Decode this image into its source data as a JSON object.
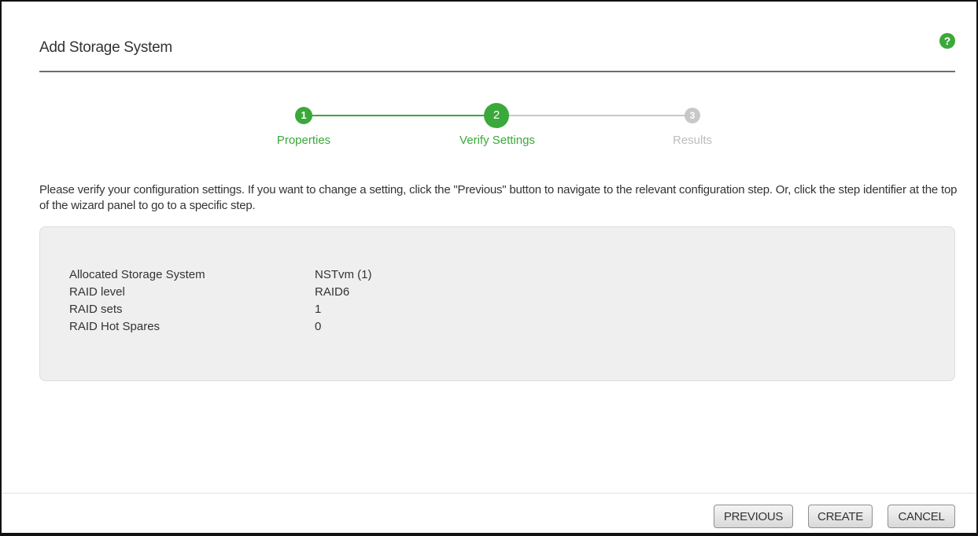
{
  "dialog": {
    "title": "Add Storage System",
    "help_icon": "?"
  },
  "stepper": {
    "steps": [
      {
        "number": "1",
        "label": "Properties",
        "state": "completed"
      },
      {
        "number": "2",
        "label": "Verify Settings",
        "state": "current"
      },
      {
        "number": "3",
        "label": "Results",
        "state": "pending"
      }
    ]
  },
  "instructions": "Please verify your configuration settings. If you want to change a setting, click the \"Previous\" button to navigate to the relevant configuration step. Or, click the step identifier at the top of the wizard panel to go to a specific step.",
  "summary": {
    "rows": [
      {
        "label": "Allocated Storage System",
        "value": "NSTvm (1)"
      },
      {
        "label": "RAID level",
        "value": "RAID6"
      },
      {
        "label": "RAID sets",
        "value": "1"
      },
      {
        "label": "RAID Hot Spares",
        "value": "0"
      }
    ]
  },
  "footer": {
    "previous_label": "PREVIOUS",
    "create_label": "CREATE",
    "cancel_label": "CANCEL"
  },
  "colors": {
    "accent_green": "#3aa83a",
    "pending_gray": "#c8c8c8",
    "panel_bg": "#efefef"
  }
}
